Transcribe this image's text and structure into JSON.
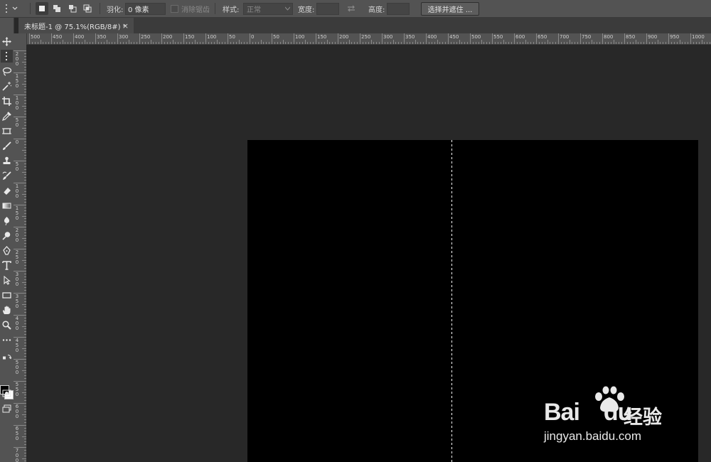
{
  "options_bar": {
    "feather_label": "羽化:",
    "feather_value": "0 像素",
    "antialias_label": "消除锯齿",
    "style_label": "样式:",
    "style_value": "正常",
    "width_label": "宽度:",
    "height_label": "高度:",
    "select_mask_button": "选择并遮住 ..."
  },
  "document_tab": {
    "title": "未标题-1 @ 75.1%(RGB/8#) *",
    "close": "×"
  },
  "ruler_top_labels": [
    "500",
    "450",
    "400",
    "350",
    "300",
    "250",
    "200",
    "150",
    "100",
    "50",
    "0",
    "50",
    "100",
    "150",
    "200",
    "250",
    "300",
    "350",
    "400",
    "450",
    "500",
    "550",
    "600",
    "650",
    "700",
    "750",
    "800",
    "850",
    "900",
    "950",
    "1000"
  ],
  "ruler_left_labels": [
    "2|0|0",
    "1|5|0",
    "1|0|0",
    "5|0",
    "0",
    "5|0",
    "1|0|0",
    "1|5|0",
    "2|0|0",
    "2|5|0",
    "3|0|0",
    "3|5|0",
    "4|0|0",
    "4|5|0",
    "5|0|0",
    "5|5|0",
    "6|0|0",
    "6|5|0",
    "7|0|0"
  ],
  "toolbar_tools": [
    "move-tool",
    "marquee-tool",
    "lasso-tool",
    "magic-wand-tool",
    "crop-tool",
    "eyedropper-tool",
    "frame-tool",
    "brush-tool",
    "stamp-tool",
    "history-brush-tool",
    "eraser-tool",
    "gradient-tool",
    "blur-tool",
    "dodge-tool",
    "pen-tool",
    "type-tool",
    "path-select-tool",
    "rectangle-tool",
    "hand-tool",
    "zoom-tool",
    "more-tools"
  ],
  "watermark": {
    "brand": "Bai",
    "brand_tail": "du",
    "cn": "经验",
    "url": "jingyan.baidu.com"
  }
}
